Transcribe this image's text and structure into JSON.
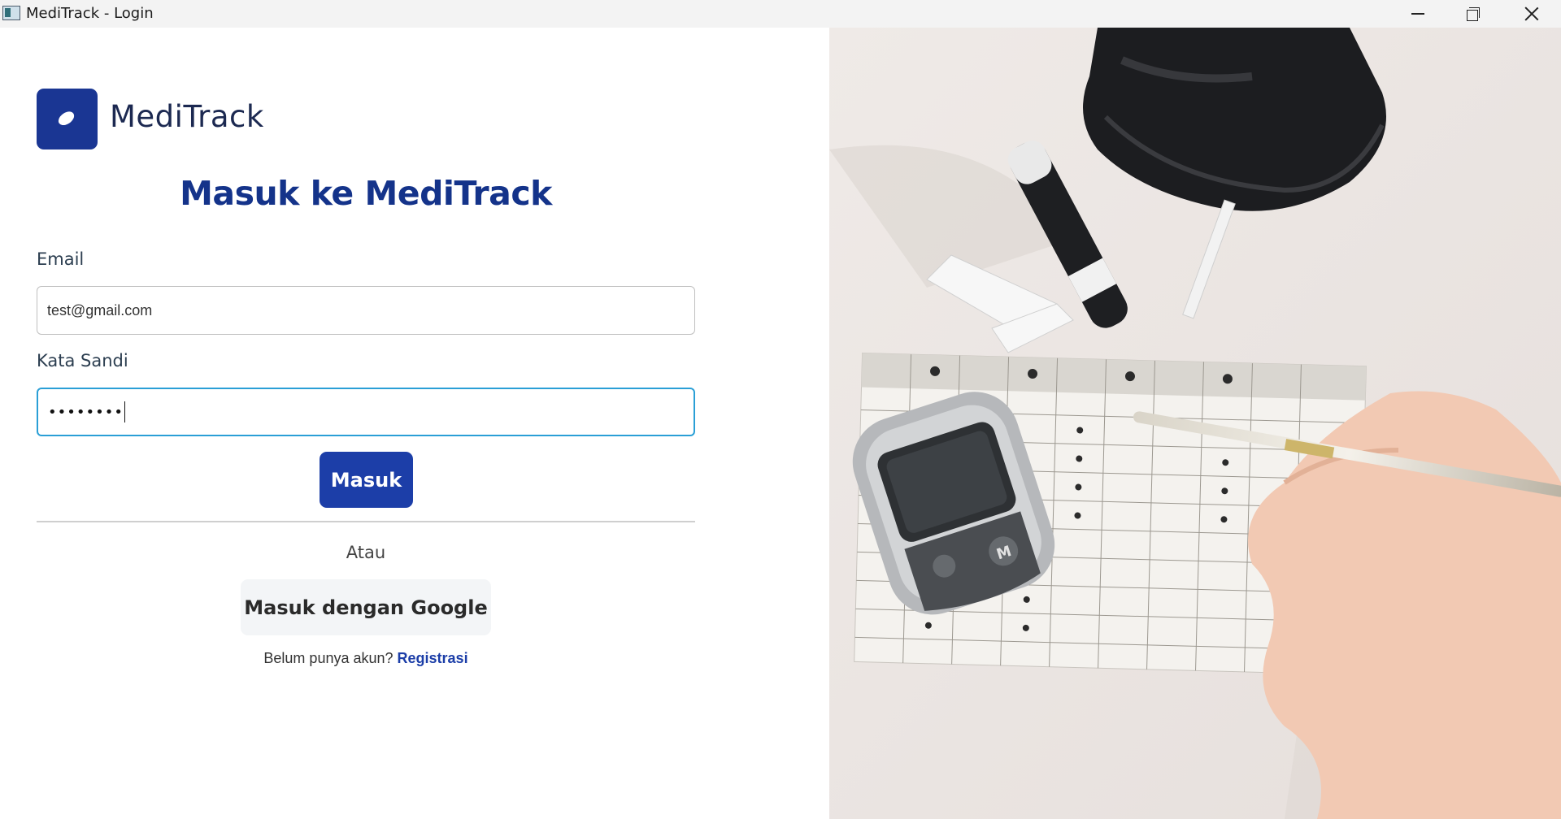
{
  "window": {
    "title": "MediTrack - Login"
  },
  "brand": {
    "name": "MediTrack"
  },
  "login": {
    "heading": "Masuk ke MediTrack",
    "email_label": "Email",
    "email_value": "test@gmail.com",
    "password_label": "Kata Sandi",
    "password_mask": "••••••••",
    "submit_label": "Masuk",
    "or_text": "Atau",
    "google_label": "Masuk dengan Google",
    "register_prompt": "Belum punya akun?",
    "register_link": "Registrasi"
  },
  "colors": {
    "primary": "#1c3ea8",
    "heading": "#14338a",
    "focus_border": "#2a9fd6"
  },
  "icons": {
    "logo": "bandage-icon",
    "minimize": "minimize-icon",
    "maximize": "restore-icon",
    "close": "close-icon"
  }
}
